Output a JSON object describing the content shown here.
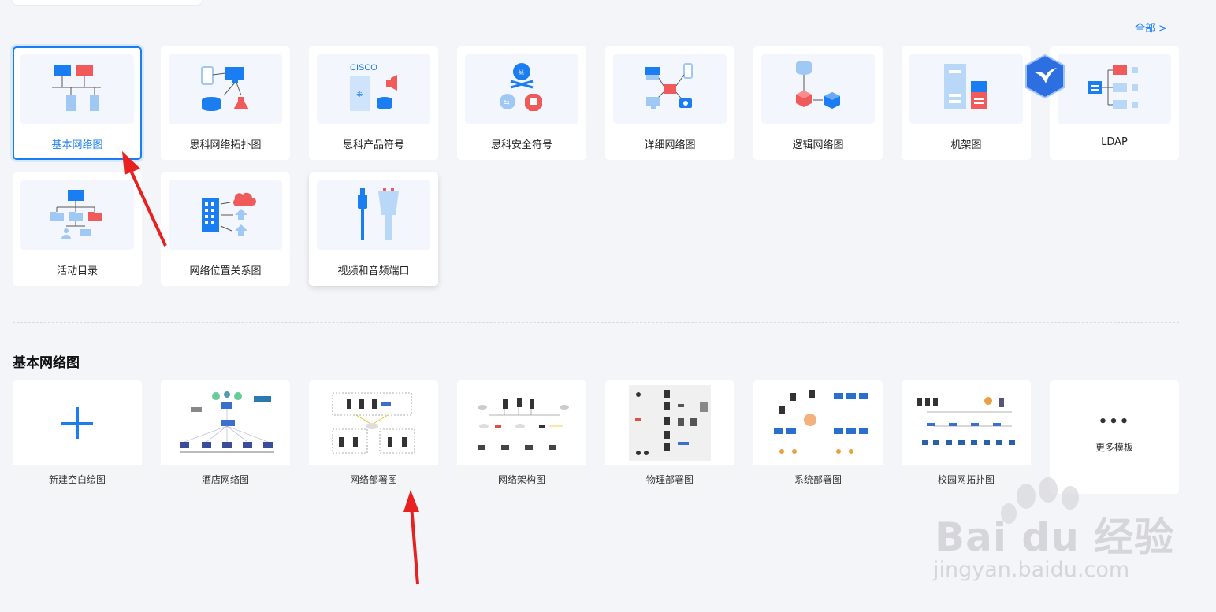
{
  "header": {
    "all_link": "全部  >"
  },
  "categories": [
    {
      "label": "基本网络图",
      "icon": "basic-network-icon"
    },
    {
      "label": "思科网络拓扑图",
      "icon": "cisco-topology-icon"
    },
    {
      "label": "思科产品符号",
      "icon": "cisco-product-icon",
      "thumb_text": "CISCO"
    },
    {
      "label": "思科安全符号",
      "icon": "cisco-security-icon"
    },
    {
      "label": "详细网络图",
      "icon": "detailed-network-icon"
    },
    {
      "label": "逻辑网络图",
      "icon": "logical-network-icon"
    },
    {
      "label": "机架图",
      "icon": "rack-icon"
    },
    {
      "label": "LDAP",
      "icon": "ldap-icon"
    },
    {
      "label": "活动目录",
      "icon": "active-directory-icon"
    },
    {
      "label": "网络位置关系图",
      "icon": "network-location-icon"
    },
    {
      "label": "视频和音频端口",
      "icon": "av-port-icon"
    }
  ],
  "section": {
    "title": "基本网络图"
  },
  "templates": [
    {
      "label": "新建空白绘图",
      "icon": "plus-icon"
    },
    {
      "label": "酒店网络图"
    },
    {
      "label": "网络部署图"
    },
    {
      "label": "网络架构图"
    },
    {
      "label": "物理部署图"
    },
    {
      "label": "系统部署图"
    },
    {
      "label": "校园网拓扑图"
    }
  ],
  "more": {
    "dots": "•••",
    "label": "更多模板"
  },
  "watermark": {
    "brand": "Bai du 经验",
    "url": "jingyan.baidu.com"
  },
  "colors": {
    "accent": "#1a7df2",
    "red": "#f05a5a",
    "light_blue": "#9fc8f5"
  }
}
